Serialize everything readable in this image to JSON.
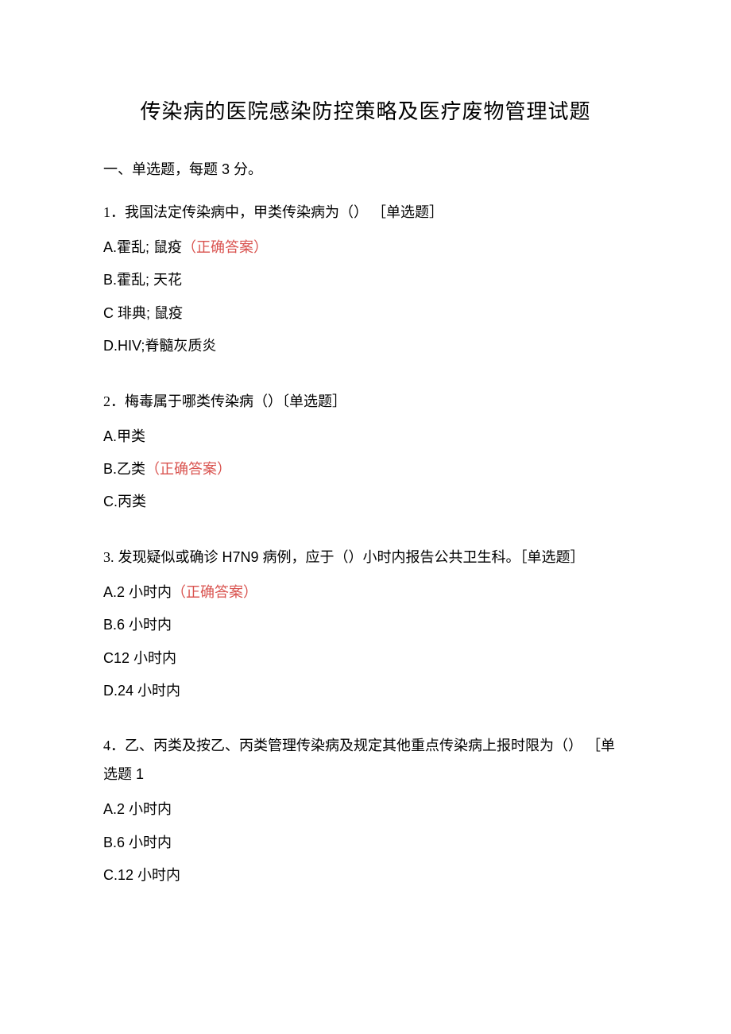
{
  "title": "传染病的医院感染防控策略及医疗废物管理试题",
  "section_header": "一、单选题，每题 3 分。",
  "questions": [
    {
      "num": "1",
      "text": "．我国法定传染病中，甲类传染病为（） ［单选题］",
      "options": [
        {
          "label": "A.霍乱; 鼠疫",
          "correct": true
        },
        {
          "label": "B.霍乱; 天花",
          "correct": false
        },
        {
          "label": "C 琲典; 鼠疫",
          "correct": false
        },
        {
          "label": "D.HIV;脊髓灰质炎",
          "correct": false
        }
      ]
    },
    {
      "num": "2",
      "text": "．梅毒属于哪类传染病（）〔单选题］",
      "options": [
        {
          "label": "A.甲类",
          "correct": false
        },
        {
          "label": "B.乙类",
          "correct": true
        },
        {
          "label": "C.丙类",
          "correct": false
        }
      ]
    },
    {
      "num": "3.",
      "text": " 发现疑似或确诊 H7N9 病例，应于（）小时内报告公共卫生科。［单选题］",
      "options": [
        {
          "label": "A.2 小时内",
          "correct": true
        },
        {
          "label": "B.6 小时内",
          "correct": false
        },
        {
          "label": "C12 小时内",
          "correct": false
        },
        {
          "label": "D.24 小时内",
          "correct": false
        }
      ]
    },
    {
      "num": "4",
      "text": "．乙、丙类及按乙、丙类管理传染病及规定其他重点传染病上报时限为（） ［单选题 1",
      "options": [
        {
          "label": "A.2 小时内",
          "correct": false
        },
        {
          "label": "B.6 小时内",
          "correct": false
        },
        {
          "label": "C.12 小时内",
          "correct": false
        }
      ]
    }
  ],
  "correct_marker": "（正确答案）"
}
